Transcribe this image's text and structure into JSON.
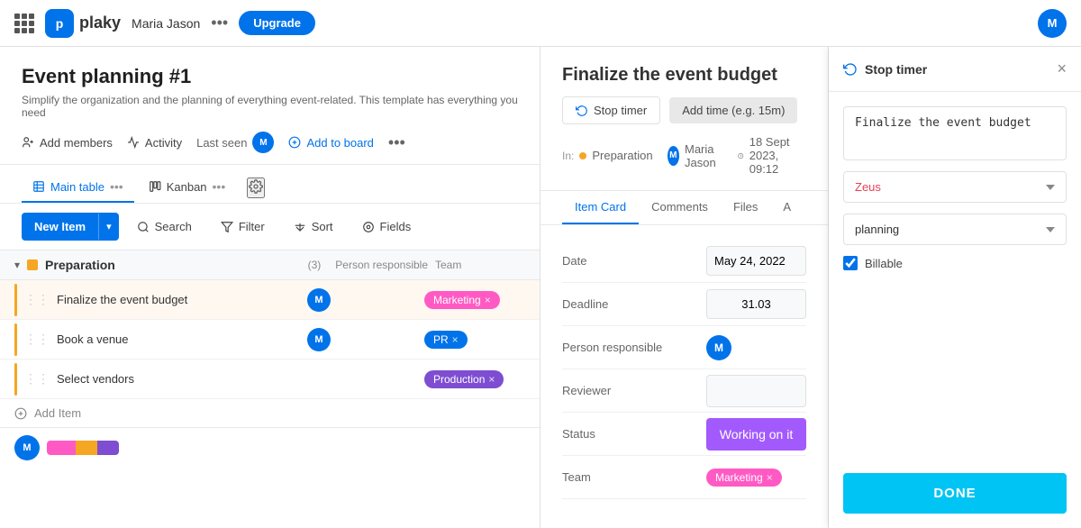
{
  "topnav": {
    "logo_text": "plaky",
    "logo_initial": "p",
    "user_name": "Maria Jason",
    "upgrade_label": "Upgrade",
    "avatar_initial": "M"
  },
  "board": {
    "title": "Event planning #1",
    "description": "Simplify the organization and the planning of everything event-related. This template has everything you need",
    "actions": {
      "add_members": "Add members",
      "activity": "Activity",
      "last_seen": "Last seen",
      "add_to_board": "Add to board"
    },
    "views": {
      "main_table": "Main table",
      "kanban": "Kanban"
    }
  },
  "toolbar": {
    "new_item": "New Item",
    "search": "Search",
    "filter": "Filter",
    "sort": "Sort",
    "fields": "Fields"
  },
  "groups": [
    {
      "name": "Preparation",
      "count": "(3)",
      "color": "#f5a623",
      "rows": [
        {
          "task": "Finalize the event budget",
          "person_initial": "M",
          "team": "Marketing",
          "team_color": "marketing"
        },
        {
          "task": "Book a venue",
          "person_initial": "M",
          "team": "PR",
          "team_color": "pr"
        },
        {
          "task": "Select vendors",
          "person_initial": "",
          "team": "Production",
          "team_color": "production"
        }
      ],
      "add_item": "Add Item"
    }
  ],
  "detail": {
    "title": "Finalize the event budget",
    "timer_stop": "Stop timer",
    "timer_add": "Add time (e.g. 15m)",
    "meta_in": "Preparation",
    "meta_user": "Maria Jason",
    "meta_date": "18 Sept 2023, 09:12",
    "tabs": [
      "Item Card",
      "Comments",
      "Files",
      "A"
    ],
    "fields": [
      {
        "label": "Date",
        "value": "May 24, 2022",
        "type": "date"
      },
      {
        "label": "Deadline",
        "value": "31.03",
        "type": "text"
      },
      {
        "label": "Person responsible",
        "value": "M",
        "type": "avatar"
      },
      {
        "label": "Reviewer",
        "value": "",
        "type": "text"
      },
      {
        "label": "Status",
        "value": "Working on it",
        "type": "status"
      },
      {
        "label": "Team",
        "value": "Marketing",
        "type": "team"
      }
    ]
  },
  "timer_panel": {
    "title": "Stop timer",
    "task_text": "Finalize the event budget",
    "project": "Zeus",
    "category": "planning",
    "billable_label": "Billable",
    "done_label": "DONE"
  },
  "icons": {
    "grid": "⋮⋮⋮",
    "refresh": "↻",
    "members": "👥",
    "activity": "📈",
    "clock": "🕐",
    "plus_circle": "⊕",
    "table": "▦",
    "kanban": "⊞",
    "settings": "⚙",
    "chevron_down": "▾",
    "search": "🔍",
    "filter": "⊘",
    "sort": "⇅",
    "fields": "◎",
    "drag": "⋮⋮",
    "close": "×",
    "timer": "↺",
    "calendar": "📅"
  }
}
